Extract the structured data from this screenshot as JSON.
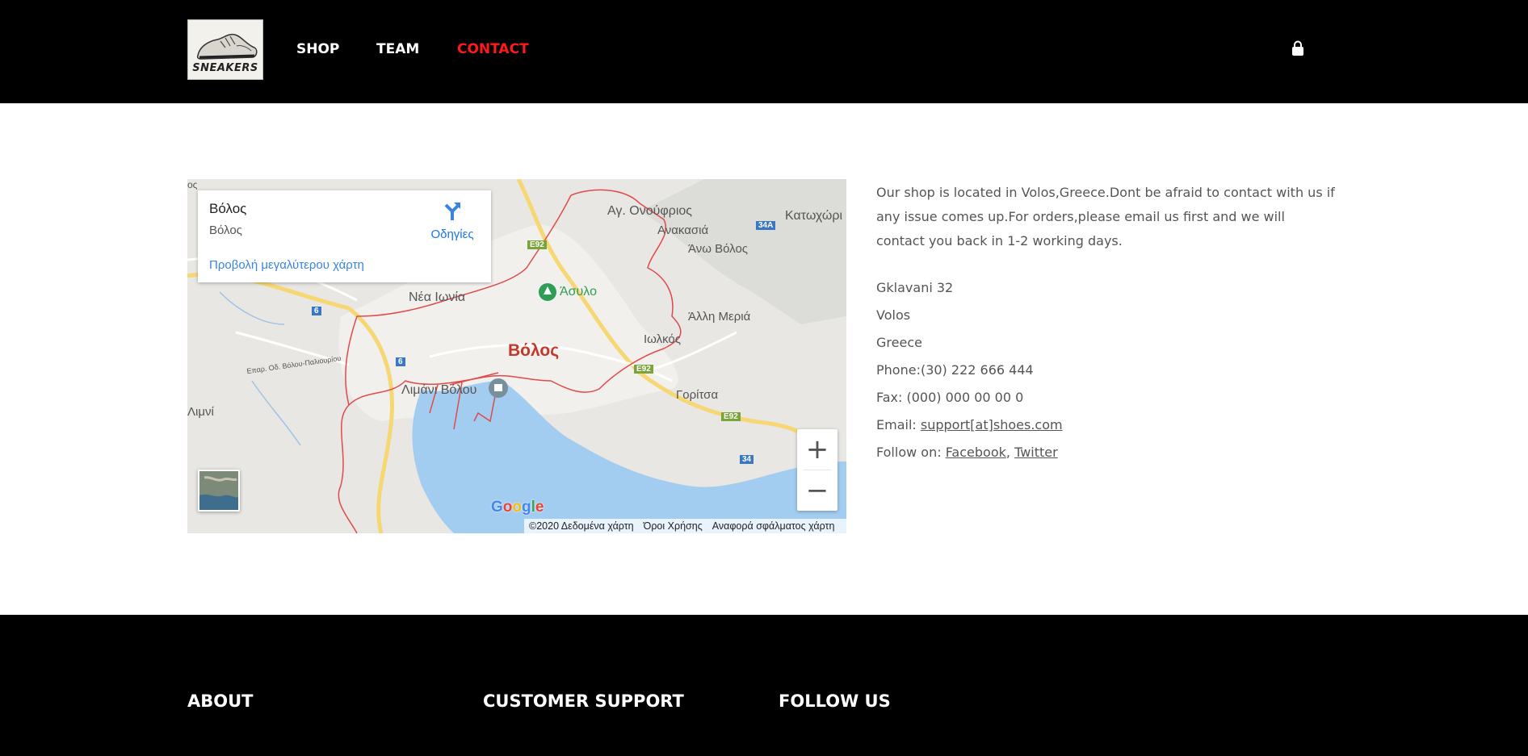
{
  "header": {
    "logo_text": "SNEAKERS",
    "nav": [
      {
        "label": "SHOP",
        "active": false
      },
      {
        "label": "TEAM",
        "active": false
      },
      {
        "label": "CONTACT",
        "active": true
      }
    ],
    "cart_icon": "shopping-bag-icon",
    "active_color": "#ff1a1a"
  },
  "map": {
    "place_card": {
      "title": "Βόλος",
      "subtitle": "Βόλος",
      "directions_label": "Οδηγίες",
      "larger_map_link": "Προβολή μεγαλύτερου χάρτη"
    },
    "labels": {
      "city": "Βόλος",
      "nea_ionia": "Νέα Ιωνία",
      "asylo": "Άσυλο",
      "ag_onoufrios": "Αγ. Ονούφριος",
      "anakasia": "Ανακασιά",
      "ano_volos": "Άνω Βόλος",
      "katochori": "Κατωχώρι",
      "alli_meria": "Άλλη Μεριά",
      "iolkos": "Ιωλκός",
      "goritsa": "Γορίτσα",
      "port": "Λιμάνι Βόλου",
      "limni": "Λιμνί",
      "road_epar": "Επαρ. Οδ. Βόλου-Παλιουρίου",
      "road_e92_a": "E92",
      "road_e92_b": "E92",
      "road_e92_c": "E92",
      "road_34a": "34A",
      "road_34": "34",
      "road_6a": "6",
      "road_6b": "6"
    },
    "zoom_in": "+",
    "zoom_out": "−",
    "google": "Google",
    "attribution": [
      "©2020 Δεδομένα χάρτη",
      "Όροι Χρήσης",
      "Αναφορά σφάλματος χάρτη"
    ]
  },
  "info": {
    "description": "Our shop is located in Volos,Greece.Dont be afraid to contact with us if any issue comes up.For orders,please email us first and we will contact you back in 1-2 working days.",
    "address_street": "Gklavani 32",
    "address_city": "Volos",
    "address_country": "Greece",
    "phone": "Phone:(30) 222 666 444",
    "fax": "Fax: (000) 000 00 00 0",
    "email_prefix": "Email: ",
    "email_link": "support[at]shoes.com",
    "follow_prefix": "Follow on: ",
    "facebook": "Facebook",
    "separator": ",",
    "twitter": "Twitter"
  },
  "footer": {
    "about": "ABOUT",
    "customer_support": "CUSTOMER SUPPORT",
    "follow_us": "FOLLOW US"
  }
}
